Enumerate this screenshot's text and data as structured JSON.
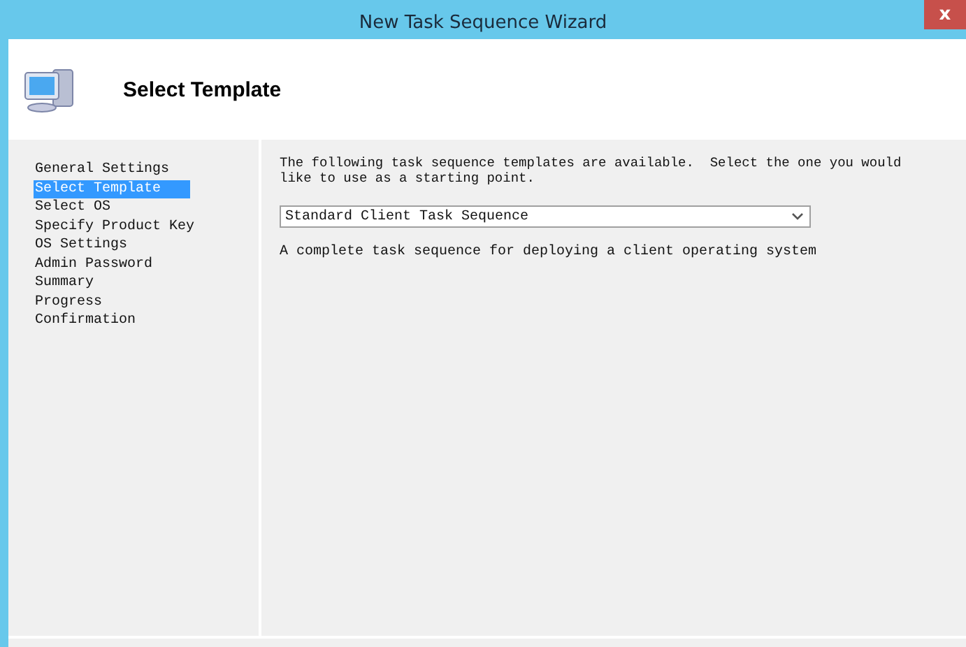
{
  "window": {
    "title": "New Task Sequence Wizard",
    "close": "x"
  },
  "header": {
    "title": "Select Template"
  },
  "sidebar": {
    "items": [
      {
        "label": "General Settings",
        "selected": false
      },
      {
        "label": "Select Template",
        "selected": true
      },
      {
        "label": "Select OS",
        "selected": false
      },
      {
        "label": "Specify Product Key",
        "selected": false
      },
      {
        "label": "OS Settings",
        "selected": false
      },
      {
        "label": "Admin Password",
        "selected": false
      },
      {
        "label": "Summary",
        "selected": false
      },
      {
        "label": "Progress",
        "selected": false
      },
      {
        "label": "Confirmation",
        "selected": false
      }
    ]
  },
  "content": {
    "intro": "The following task sequence templates are available.  Select the one you would like to use as a starting point.",
    "template": {
      "value": "Standard Client Task Sequence"
    },
    "description": "A complete task sequence for deploying a client operating system"
  }
}
